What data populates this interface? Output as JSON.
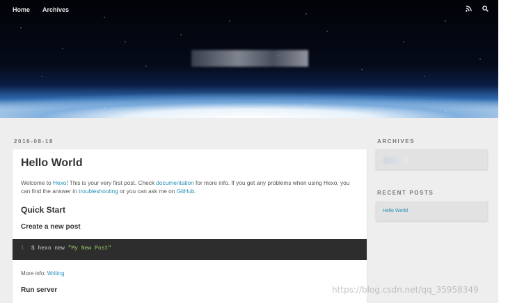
{
  "nav": {
    "home": "Home",
    "archives": "Archives",
    "icons": [
      "rss-icon",
      "search-icon"
    ]
  },
  "site": {
    "title": ""
  },
  "post": {
    "date": "2016-08-18",
    "title": "Hello World",
    "intro": {
      "p1": "Welcome to ",
      "hexo_link": "Hexo",
      "p2": "! This is your very first post. Check ",
      "doc_link": "documentation",
      "p3": " for more info. If you get any problems when using Hexo, you can find the answer in ",
      "troubleshooting_link": "troubleshooting",
      "p4": " or you can ask me on ",
      "github_link": "GitHub",
      "p5": "."
    },
    "quick_start": "Quick Start",
    "create_post": "Create a new post",
    "code": {
      "line_number": "1",
      "command": "$ hexo new ",
      "string": "\"My New Post\""
    },
    "more_info_label": "More info: ",
    "more_info_link": "Writing",
    "run_server": "Run server"
  },
  "sidebar": {
    "archives_title": "ARCHIVES",
    "recent_title": "RECENT POSTS",
    "recent_posts": [
      "Hello World"
    ]
  },
  "watermark": "https://blog.csdn.net/qq_35958349",
  "colors": {
    "link": "#258fb8",
    "code_bg": "#2d2d2d",
    "body_bg": "#eeeeee"
  }
}
